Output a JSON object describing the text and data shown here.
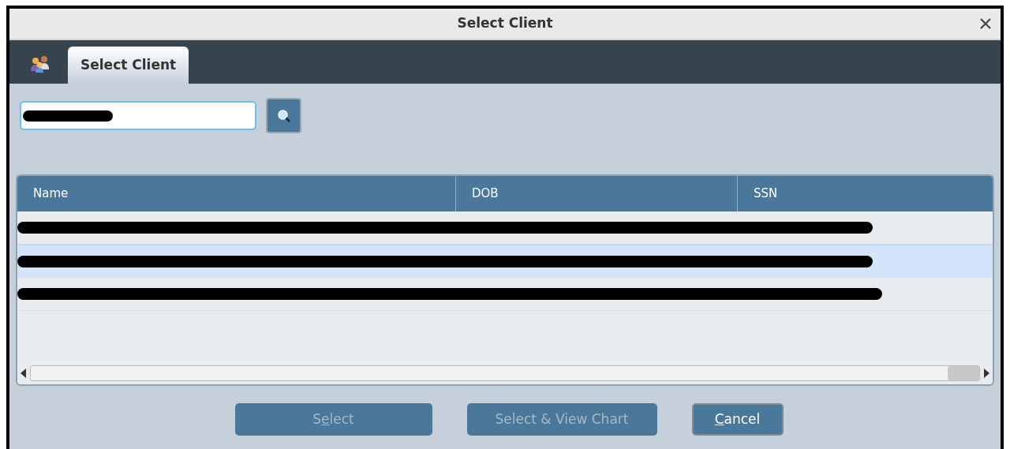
{
  "window": {
    "title": "Select Client"
  },
  "tabs": [
    {
      "label": "Select Client",
      "selected": true
    }
  ],
  "search": {
    "redacted": true
  },
  "table": {
    "columns": [
      "Name",
      "DOB",
      "SSN"
    ],
    "rows": [
      {
        "redacted": true,
        "selected": false
      },
      {
        "redacted": true,
        "selected": true
      },
      {
        "redacted": true,
        "selected": false
      }
    ]
  },
  "buttons": [
    {
      "pre": "S",
      "key": "e",
      "post": "lect",
      "disabled": true
    },
    {
      "pre": "Select & View Chart",
      "disabled": true
    },
    {
      "key": "C",
      "post": "ancel",
      "disabled": false
    }
  ]
}
